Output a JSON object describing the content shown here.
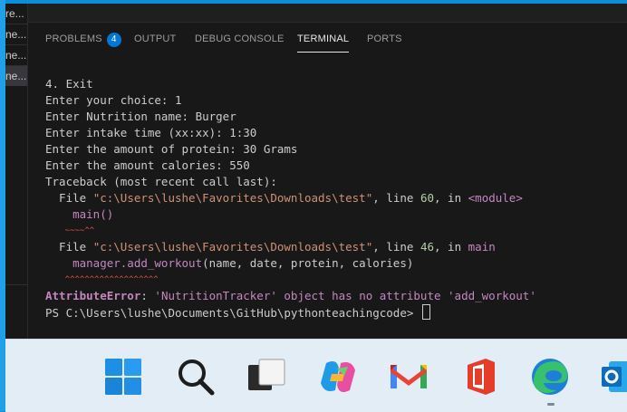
{
  "explorer": {
    "tabs": [
      "re...",
      "ne...",
      "ne...",
      "ne..."
    ]
  },
  "panel": {
    "tabs": [
      {
        "label": "PROBLEMS",
        "badge": "4"
      },
      {
        "label": "OUTPUT"
      },
      {
        "label": "DEBUG CONSOLE"
      },
      {
        "label": "TERMINAL",
        "active": true
      },
      {
        "label": "PORTS"
      }
    ]
  },
  "terminal": {
    "exit_line": "4. Exit",
    "choice": "Enter your choice: 1",
    "nutrition_name": "Enter Nutrition name: Burger",
    "intake_time": "Enter intake time (xx:xx): 1:30",
    "protein": "Enter the amount of protein: 30 Grams",
    "calories": "Enter the amount calories: 550",
    "traceback_header": "Traceback (most recent call last):",
    "frame1": {
      "prefix": "  File ",
      "path": "\"c:\\Users\\lushe\\Favorites\\Downloads\\test\"",
      "mid": ", line ",
      "line": "60",
      "in": ", in ",
      "func": "<module>",
      "code": "    main()",
      "marker": "    ~~~~^^"
    },
    "frame2": {
      "prefix": "  File ",
      "path": "\"c:\\Users\\lushe\\Favorites\\Downloads\\test\"",
      "mid": ", line ",
      "line": "46",
      "in": ", in ",
      "func": "main",
      "code_call": "    manager.add_workout",
      "code_args": "(name, date, protein, calories)",
      "marker": "    ^^^^^^^^^^^^^^^^^^^"
    },
    "error_type": "AttributeError",
    "error_colon": ": ",
    "error_message": "'NutritionTracker' object has no attribute 'add_workout'",
    "prompt": "PS C:\\Users\\lushe\\Documents\\GitHub\\pythonteachingcode> "
  },
  "taskbar": {
    "icons": [
      "windows-start-icon",
      "search-icon",
      "task-view-icon",
      "copilot-icon",
      "gmail-icon",
      "office-icon",
      "edge-icon",
      "outlook-icon"
    ]
  }
}
